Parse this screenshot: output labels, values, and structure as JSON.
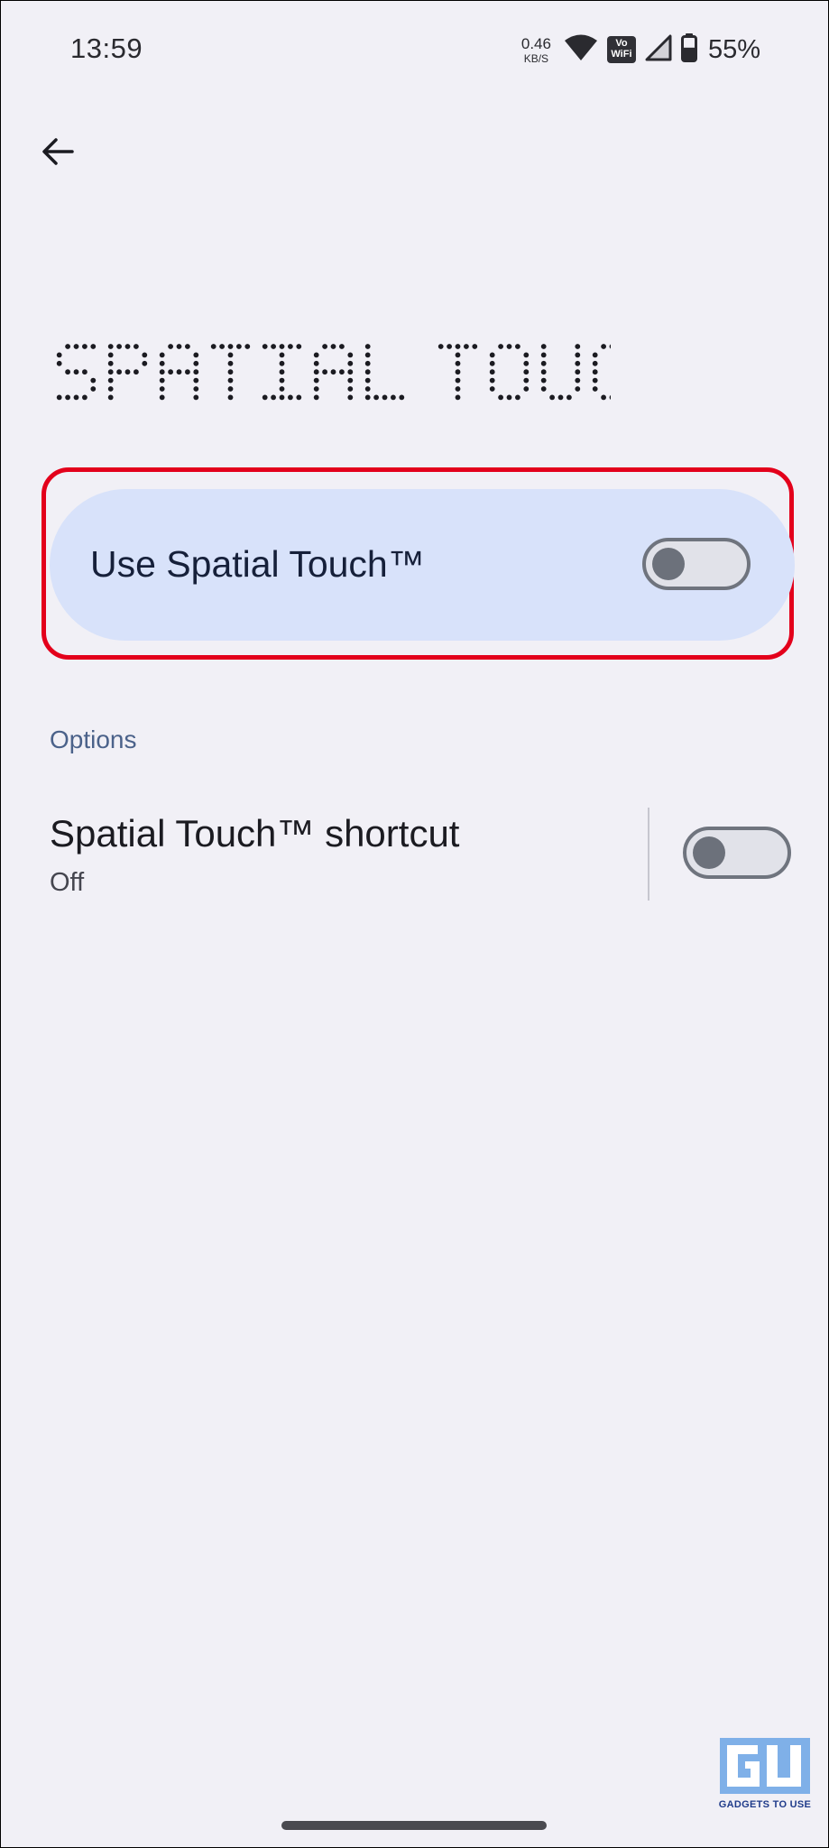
{
  "status_bar": {
    "time": "13:59",
    "net_speed_value": "0.46",
    "net_speed_unit": "KB/S",
    "vowifi_line1": "Vo",
    "vowifi_line2": "WiFi",
    "battery_percent": "55%",
    "battery_level": 0.55,
    "icons": [
      "wifi-icon",
      "vowifi-icon",
      "cell-signal-icon",
      "battery-icon"
    ]
  },
  "header": {
    "back_icon": "arrow-back-icon",
    "title": "SPATIAL TOUCH™"
  },
  "main_toggle": {
    "label": "Use Spatial Touch™",
    "checked": false
  },
  "options": {
    "header": "Options",
    "items": [
      {
        "title": "Spatial Touch™ shortcut",
        "summary": "Off",
        "checked": false
      }
    ]
  },
  "watermark": {
    "text": "GADGETS TO USE"
  },
  "colors": {
    "background": "#f1f0f6",
    "card": "#d8e2fa",
    "highlight": "#e3001b",
    "section_header": "#4b628a",
    "switch_track": "#e1e2e9",
    "switch_thumb": "#6c717b"
  }
}
